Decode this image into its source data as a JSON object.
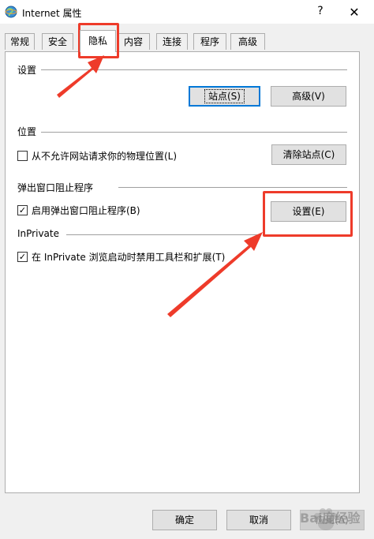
{
  "window": {
    "title": "Internet 属性",
    "help_label": "?",
    "close_label": "✕"
  },
  "tabs": [
    {
      "label": "常规"
    },
    {
      "label": "安全"
    },
    {
      "label": "隐私",
      "active": true
    },
    {
      "label": "内容"
    },
    {
      "label": "连接"
    },
    {
      "label": "程序"
    },
    {
      "label": "高级"
    }
  ],
  "settings_group": {
    "title": "设置",
    "sites_button": "站点(S)",
    "advanced_button": "高级(V)"
  },
  "location_group": {
    "title": "位置",
    "checkbox_label": "从不允许网站请求你的物理位置(L)",
    "checked": false,
    "clear_button": "清除站点(C)"
  },
  "popup_group": {
    "title": "弹出窗口阻止程序",
    "checkbox_label": "启用弹出窗口阻止程序(B)",
    "checked": true,
    "settings_button": "设置(E)"
  },
  "inprivate_group": {
    "title": "InPrivate",
    "checkbox_label": "在 InPrivate 浏览启动时禁用工具栏和扩展(T)",
    "checked": true
  },
  "footer": {
    "ok_button": "确定",
    "cancel_button": "取消",
    "apply_button": "应用(A)"
  },
  "watermark": {
    "text": "Bai度经验"
  },
  "colors": {
    "annotation_red": "#ee3b2a",
    "focus_blue": "#0078d7"
  },
  "icons": {
    "title_icon": "internet-globe-icon",
    "check_mark": "✓"
  }
}
